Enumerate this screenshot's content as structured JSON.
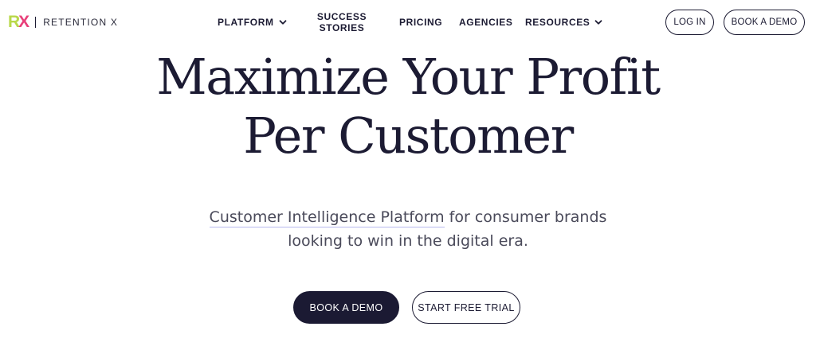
{
  "brand": {
    "mark_r": "R",
    "mark_x": "X",
    "name": "RETENTION X",
    "colors": {
      "mark_r": "#b9d84a",
      "mark_x": "#e8407a"
    }
  },
  "nav": {
    "items": [
      {
        "label": "PLATFORM",
        "has_dropdown": true,
        "icon": "chevron-down-icon"
      },
      {
        "label_line1": "SUCCESS",
        "label_line2": "STORIES",
        "has_dropdown": false
      },
      {
        "label": "PRICING",
        "has_dropdown": false
      },
      {
        "label": "AGENCIES",
        "has_dropdown": false
      },
      {
        "label": "RESOURCES",
        "has_dropdown": true,
        "icon": "chevron-down-icon"
      }
    ]
  },
  "header_actions": {
    "login_label": "LOG IN",
    "book_demo_label": "BOOK A DEMO"
  },
  "hero": {
    "title_line1": "Maximize Your Profit",
    "title_line2": "Per Customer",
    "subtitle_link": "Customer Intelligence Platform",
    "subtitle_rest": " for consumer brands",
    "subtitle_line2": "looking to win in the digital era.",
    "primary_cta": "BOOK A DEMO",
    "secondary_cta": "START FREE TRIAL"
  },
  "theme": {
    "text_dark": "#1c1b33",
    "primary_button_bg": "#1b1a33",
    "link_underline": "#b7b9ef"
  }
}
